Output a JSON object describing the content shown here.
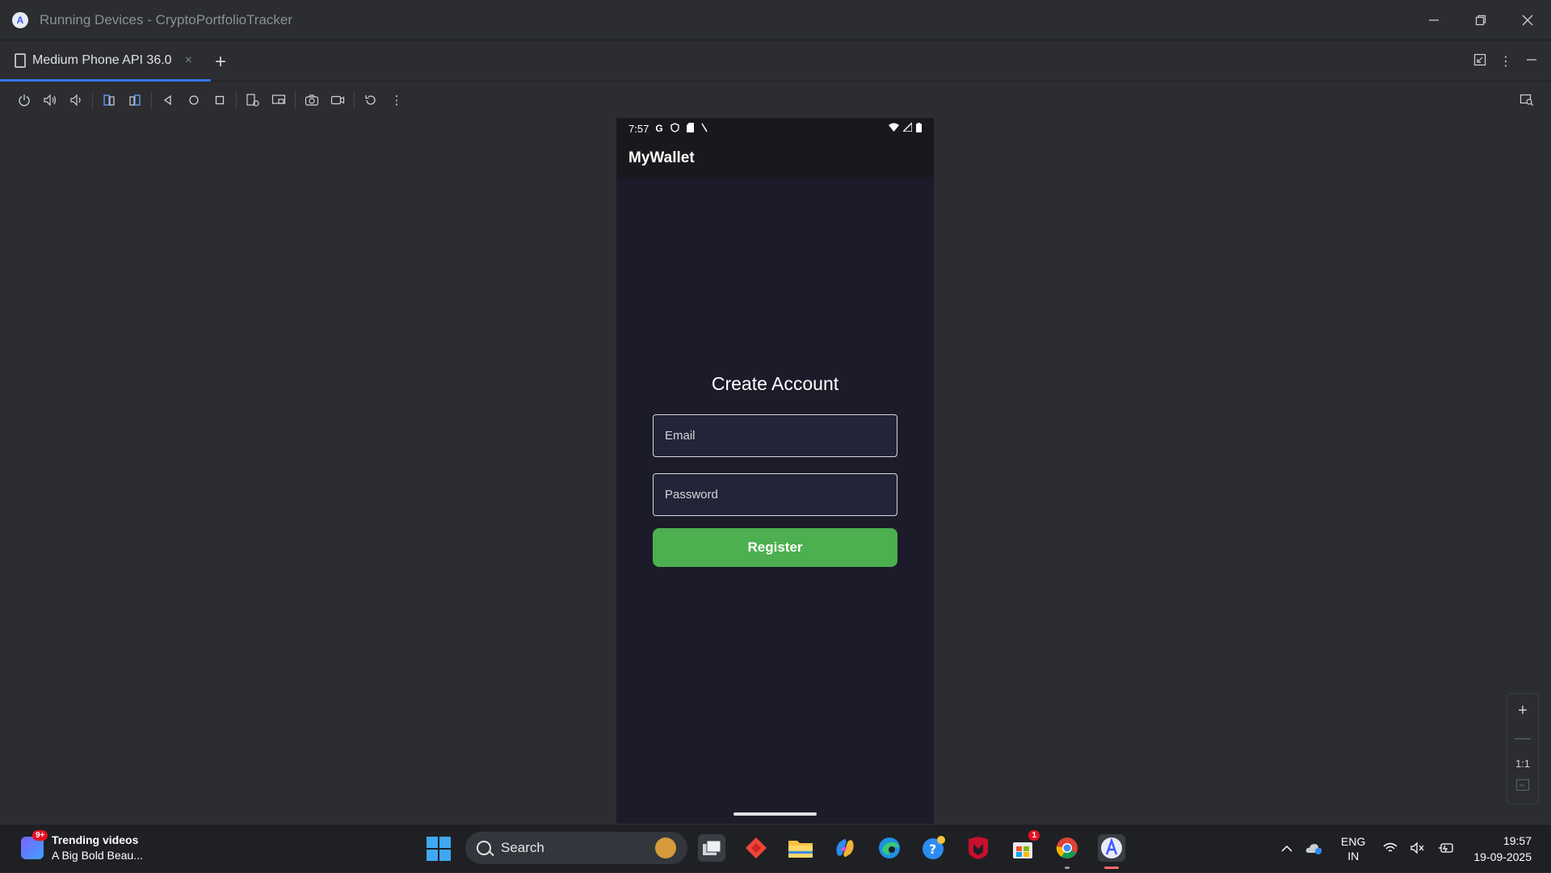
{
  "window": {
    "title": "Running Devices - CryptoPortfolioTracker",
    "controls": [
      "minimize",
      "restore",
      "close"
    ]
  },
  "tabbar": {
    "tab_label": "Medium Phone API 36.0",
    "tab_close": "×",
    "add_tab": "+"
  },
  "toolbar": {
    "icons": [
      "power-icon",
      "volume-up-icon",
      "volume-down-icon",
      "rotate-left-icon",
      "rotate-right-icon",
      "back-icon",
      "home-icon",
      "overview-icon",
      "device-settings-icon",
      "display-icon",
      "screenshot-icon",
      "screen-record-icon",
      "reset-icon",
      "more-icon"
    ]
  },
  "phone": {
    "status_time": "7:57",
    "status_g": "G",
    "app_title": "MyWallet",
    "form_title": "Create Account",
    "email_placeholder": "Email",
    "password_placeholder": "Password",
    "register_label": "Register",
    "accent_color": "#4caf50"
  },
  "zoom": {
    "zoom_in": "+",
    "zoom_out": "—",
    "actual_size": "1:1"
  },
  "taskbar": {
    "widget_badge": "9+",
    "widget_title": "Trending videos",
    "widget_subtitle": "A Big Bold Beau...",
    "search_label": "Search",
    "store_badge": "1",
    "lang_top": "ENG",
    "lang_bottom": "IN",
    "time": "19:57",
    "date": "19-09-2025"
  }
}
